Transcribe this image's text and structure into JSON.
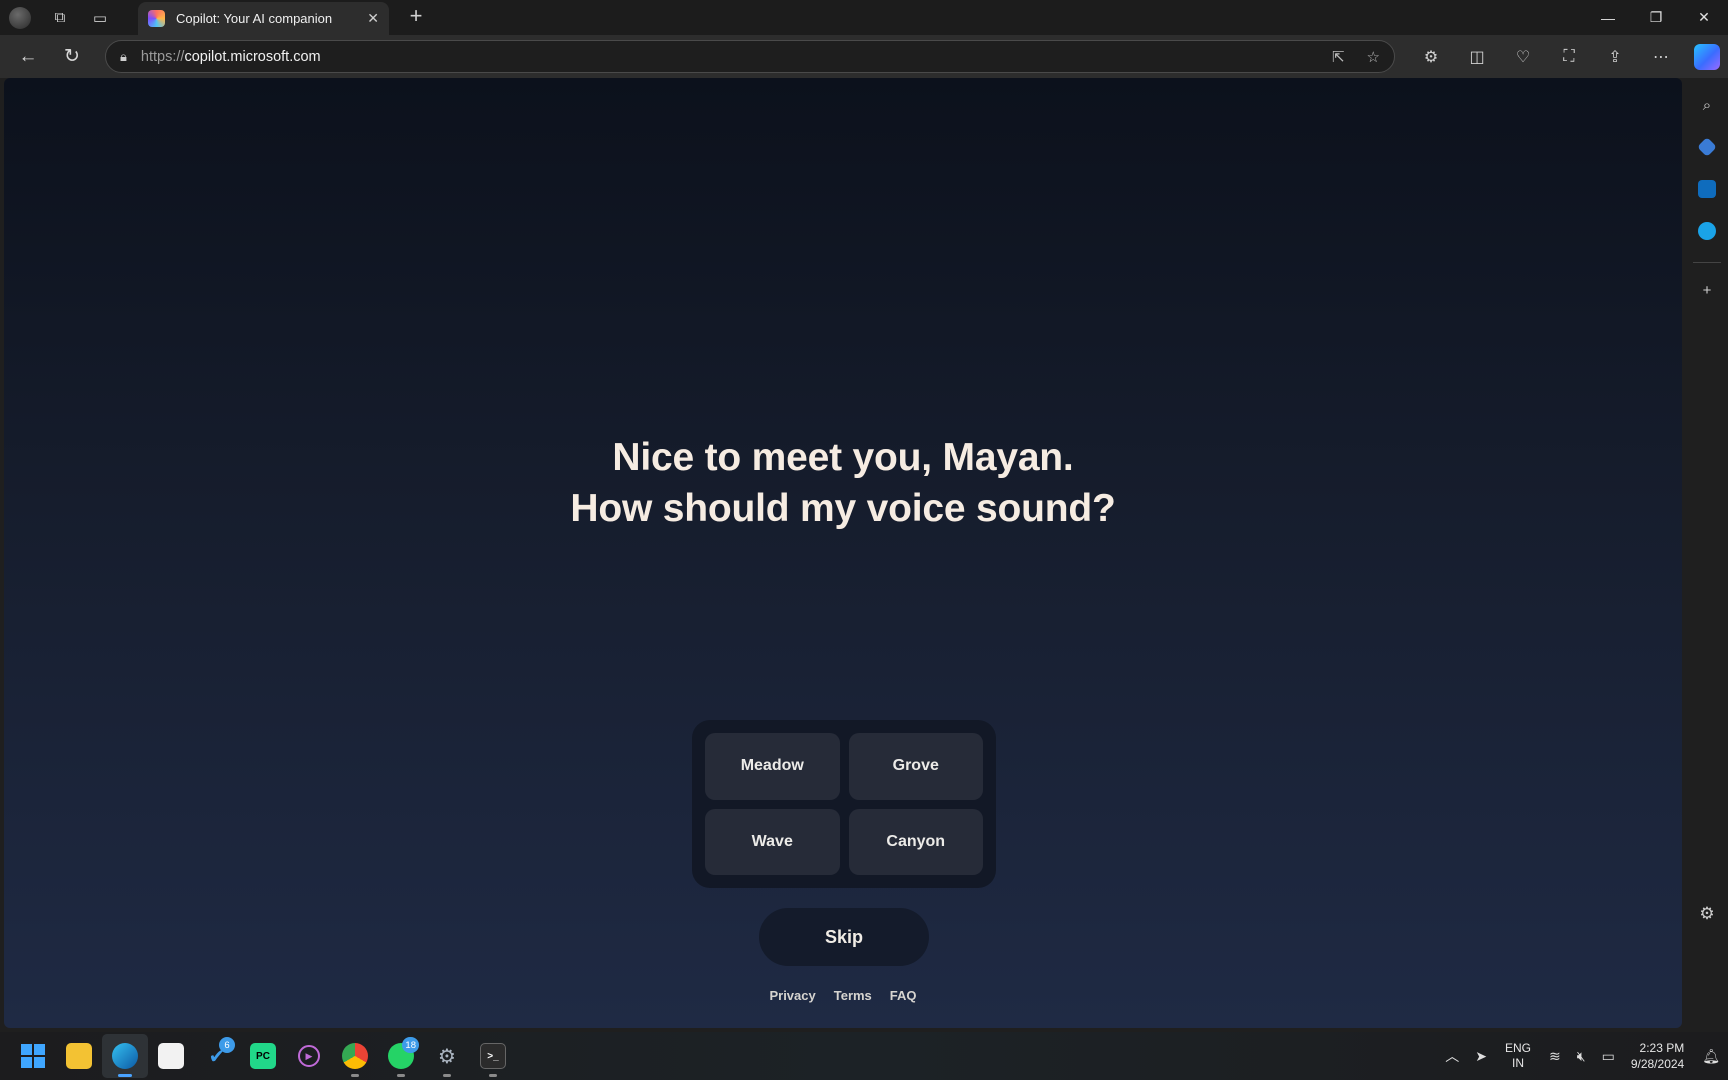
{
  "browser": {
    "tab_title": "Copilot: Your AI companion",
    "url_prefix": "https://",
    "url_host": "copilot.microsoft.com"
  },
  "page": {
    "headline_line1": "Nice to meet you, Mayan.",
    "headline_line2": "How should my voice sound?",
    "voices": [
      "Meadow",
      "Grove",
      "Wave",
      "Canyon"
    ],
    "skip_label": "Skip",
    "footer": [
      "Privacy",
      "Terms",
      "FAQ"
    ]
  },
  "taskbar": {
    "badges": {
      "todo": "6",
      "whatsapp": "18"
    },
    "language_line1": "ENG",
    "language_line2": "IN",
    "time": "2:23 PM",
    "date": "9/28/2024"
  },
  "colors": {
    "headline": "#f6ece2",
    "page_bg_top": "#0c111c",
    "page_bg_bottom": "#1f2a44"
  }
}
